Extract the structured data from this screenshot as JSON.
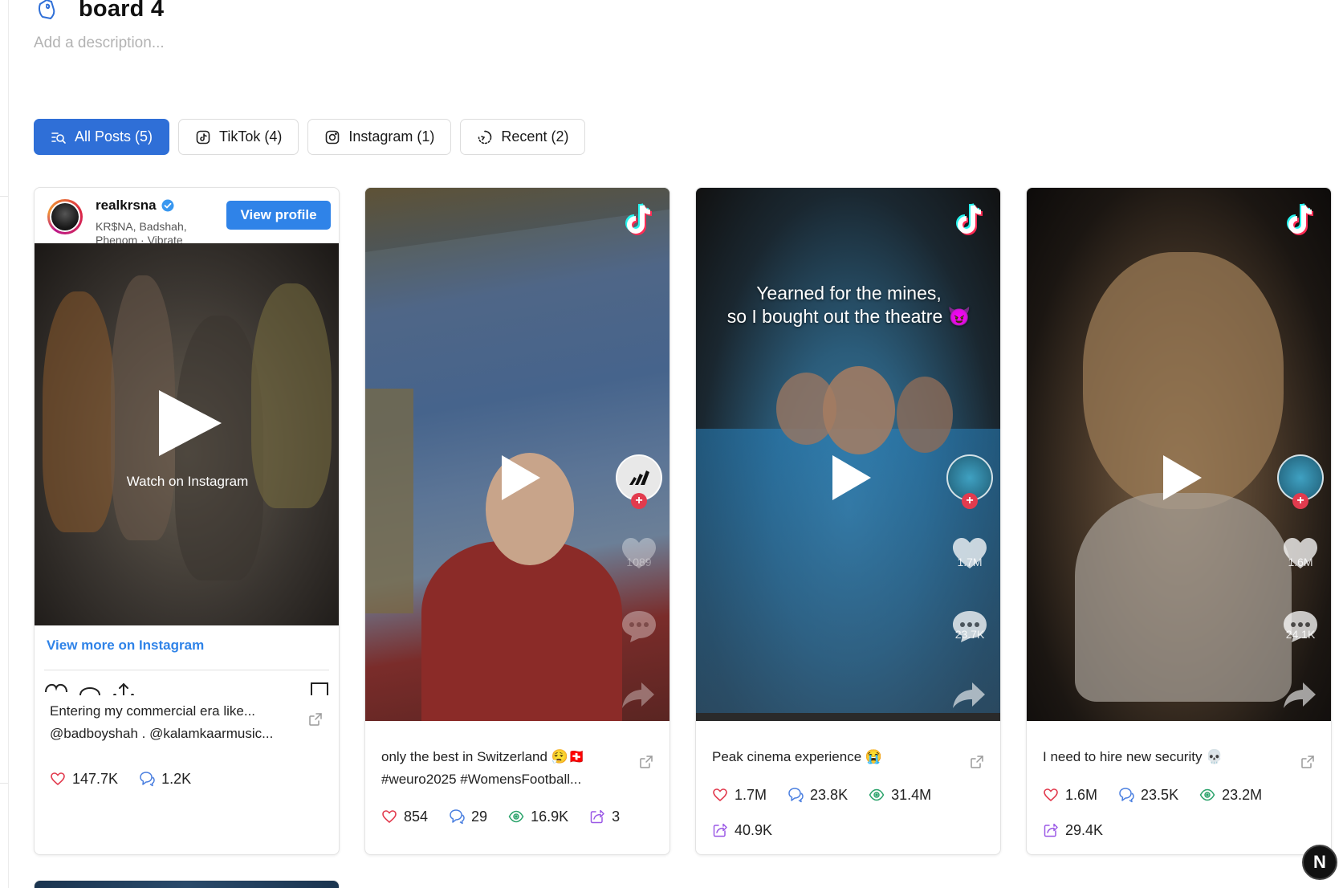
{
  "board": {
    "title": "board 4",
    "description_placeholder": "Add a description..."
  },
  "filters": [
    {
      "label": "All Posts (5)",
      "icon": "list-search-icon",
      "active": true
    },
    {
      "label": "TikTok (4)",
      "icon": "tiktok-icon",
      "active": false
    },
    {
      "label": "Instagram (1)",
      "icon": "instagram-icon",
      "active": false
    },
    {
      "label": "Recent (2)",
      "icon": "recent-icon",
      "active": false
    }
  ],
  "posts": [
    {
      "platform": "instagram",
      "username": "realkrsna",
      "verified": true,
      "subtitle": "KR$NA, Badshah, Phenom · Vibrate",
      "view_profile_label": "View profile",
      "watch_label": "Watch on Instagram",
      "view_more_label": "View more on Instagram",
      "caption_line1": "Entering my commercial era like...",
      "caption_line2": "@badboyshah . @kalamkaarmusic...",
      "likes": "147.7K",
      "comments": "1.2K"
    },
    {
      "platform": "tiktok",
      "caption_line1": "only the best in Switzerland 😮‍💨🇨🇭",
      "caption_line2": "#weuro2025 #WomensFootball...",
      "overlay_likes": "1089",
      "likes": "854",
      "comments": "29",
      "views": "16.9K",
      "shares": "3"
    },
    {
      "platform": "tiktok",
      "overlay_text_line1": "Yearned for the mines,",
      "overlay_text_line2": "so I bought out the theatre 😈",
      "caption_line1": "Peak cinema experience 😭",
      "overlay_likes": "1.7M",
      "overlay_comments": "23.7K",
      "likes": "1.7M",
      "comments": "23.8K",
      "views": "31.4M",
      "shares": "40.9K"
    },
    {
      "platform": "tiktok",
      "caption_line1": "I need to hire new security 💀",
      "overlay_likes": "1.6M",
      "overlay_comments": "24.1K",
      "likes": "1.6M",
      "comments": "23.5K",
      "views": "23.2M",
      "shares": "29.4K"
    }
  ],
  "colors": {
    "accent": "#2f6fd7",
    "instagram_link": "#2f83e8",
    "like": "#e23b4e",
    "comment": "#4a7fe0",
    "views": "#2ba36b",
    "shares": "#9b59e6"
  },
  "floating_badge": "N"
}
